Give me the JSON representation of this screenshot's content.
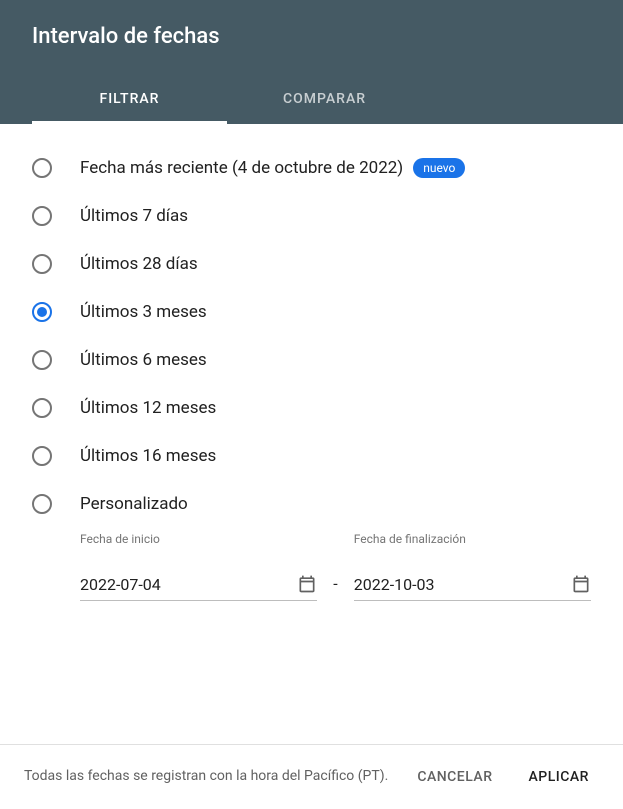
{
  "header": {
    "title": "Intervalo de fechas"
  },
  "tabs": {
    "filter": "FILTRAR",
    "compare": "COMPARAR"
  },
  "options": {
    "latest": "Fecha más reciente (4 de octubre de 2022)",
    "latest_badge": "nuevo",
    "last7": "Últimos 7 días",
    "last28": "Últimos 28 días",
    "last3m": "Últimos 3 meses",
    "last6m": "Últimos 6 meses",
    "last12m": "Últimos 12 meses",
    "last16m": "Últimos 16 meses",
    "custom": "Personalizado"
  },
  "custom": {
    "start_label": "Fecha de inicio",
    "end_label": "Fecha de finalización",
    "start_value": "2022-07-04",
    "end_value": "2022-10-03",
    "separator": "-"
  },
  "footer": {
    "note": "Todas las fechas se registran con la hora del Pacífico (PT).",
    "cancel": "CANCELAR",
    "apply": "APLICAR"
  }
}
